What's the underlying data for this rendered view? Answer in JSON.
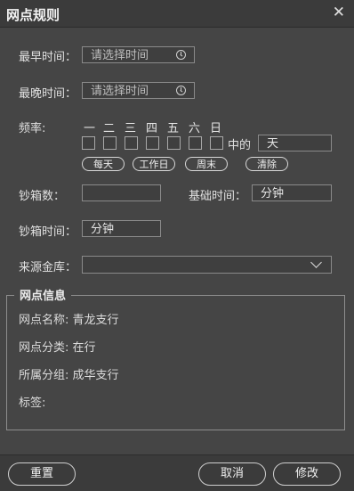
{
  "window": {
    "title": "网点规则",
    "close_glyph": "✕"
  },
  "form": {
    "earliest_label": "最早时间：",
    "earliest_placeholder": "请选择时间",
    "latest_label": "最晚时间：",
    "latest_placeholder": "请选择时间",
    "frequency_label": "频率:",
    "weekdays": [
      "一",
      "二",
      "三",
      "四",
      "五",
      "六",
      "日"
    ],
    "among_label": "中的",
    "day_unit_value": "天",
    "quick_buttons": [
      "每天",
      "工作日",
      "周末",
      "清除"
    ],
    "cashbox_count_label": "钞箱数：",
    "cashbox_count_value": "",
    "base_time_label": "基础时间：",
    "base_time_value": "分钟",
    "cashbox_time_label": "钞箱时间：",
    "cashbox_time_value": "分钟",
    "source_vault_label": "来源金库：",
    "source_vault_value": ""
  },
  "info": {
    "legend": "网点信息",
    "name": "网点名称: 青龙支行",
    "category": "网点分类: 在行",
    "group": "所属分组: 成华支行",
    "tags": "标签:"
  },
  "footer": {
    "reset": "重置",
    "cancel": "取消",
    "modify": "修改"
  }
}
